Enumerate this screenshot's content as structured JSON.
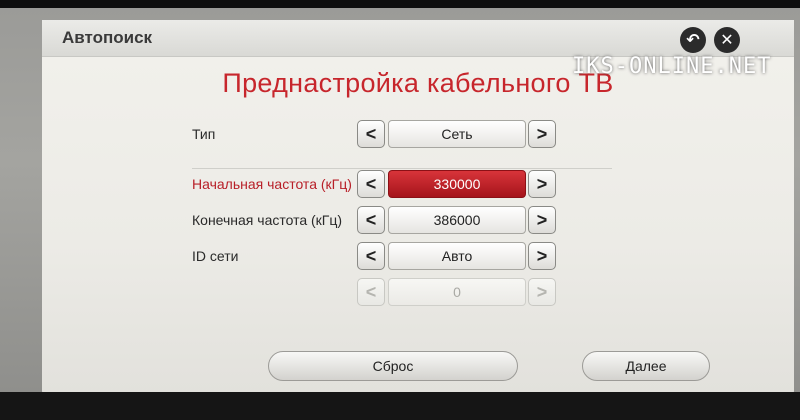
{
  "window": {
    "title": "Автопоиск"
  },
  "header_buttons": {
    "back_icon": "↶",
    "close_icon": "✕"
  },
  "heading": "Преднастройка кабельного ТВ",
  "watermark": "IKS-ONLINE.NET",
  "fields": {
    "type": {
      "label": "Тип",
      "value": "Сеть"
    },
    "start_freq": {
      "label": "Начальная частота (кГц)",
      "value": "330000"
    },
    "end_freq": {
      "label": "Конечная частота (кГц)",
      "value": "386000"
    },
    "network_id": {
      "label": "ID сети",
      "value": "Авто"
    },
    "network_id_value": {
      "value": "0"
    }
  },
  "arrows": {
    "left": "<",
    "right": ">"
  },
  "buttons": {
    "reset": "Сброс",
    "next": "Далее"
  },
  "colors": {
    "accent": "#c7262c",
    "active_field": "#b81f28"
  }
}
